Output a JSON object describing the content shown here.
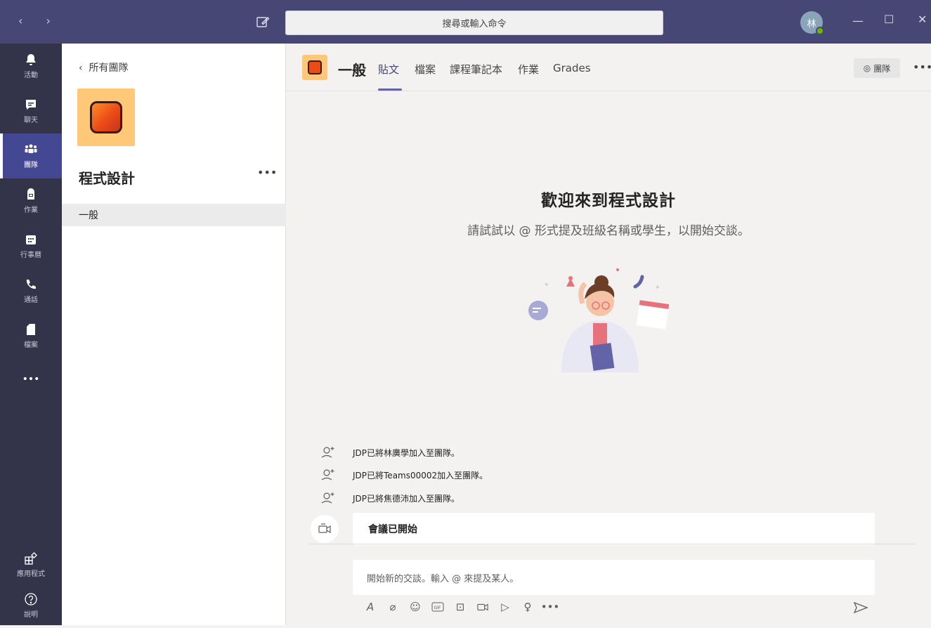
{
  "titlebar": {
    "search_placeholder": "搜尋或輸入命令",
    "avatar_initial": "林"
  },
  "rail": {
    "items": [
      {
        "label": "活動",
        "icon": "bell-icon"
      },
      {
        "label": "聊天",
        "icon": "chat-icon"
      },
      {
        "label": "團隊",
        "icon": "teams-icon"
      },
      {
        "label": "作業",
        "icon": "assignments-icon"
      },
      {
        "label": "行事曆",
        "icon": "calendar-icon"
      },
      {
        "label": "通話",
        "icon": "phone-icon"
      },
      {
        "label": "檔案",
        "icon": "files-icon"
      }
    ],
    "more": "•••",
    "apps_label": "應用程式",
    "help_label": "說明"
  },
  "leftpane": {
    "back_label": "所有團隊",
    "team_name": "程式設計",
    "more": "•••",
    "channels": [
      "一般"
    ]
  },
  "header": {
    "channel_name": "一般",
    "tabs": [
      "貼文",
      "檔案",
      "課程筆記本",
      "作業",
      "Grades"
    ],
    "active_tab": "貼文",
    "team_button": "團隊",
    "more": "•••"
  },
  "welcome": {
    "title": "歡迎來到程式設計",
    "subtitle": "請試試以 @ 形式提及班級名稱或學生，以開始交談。"
  },
  "feed": {
    "events": [
      "JDP已將林廣學加入至團隊。",
      "JDP已將Teams00002加入至團隊。",
      "JDP已將焦德沛加入至團隊。"
    ],
    "meeting_card": "會議已開始"
  },
  "composer": {
    "placeholder": "開始新的交談。輸入 @ 來提及某人。",
    "more": "•••"
  }
}
